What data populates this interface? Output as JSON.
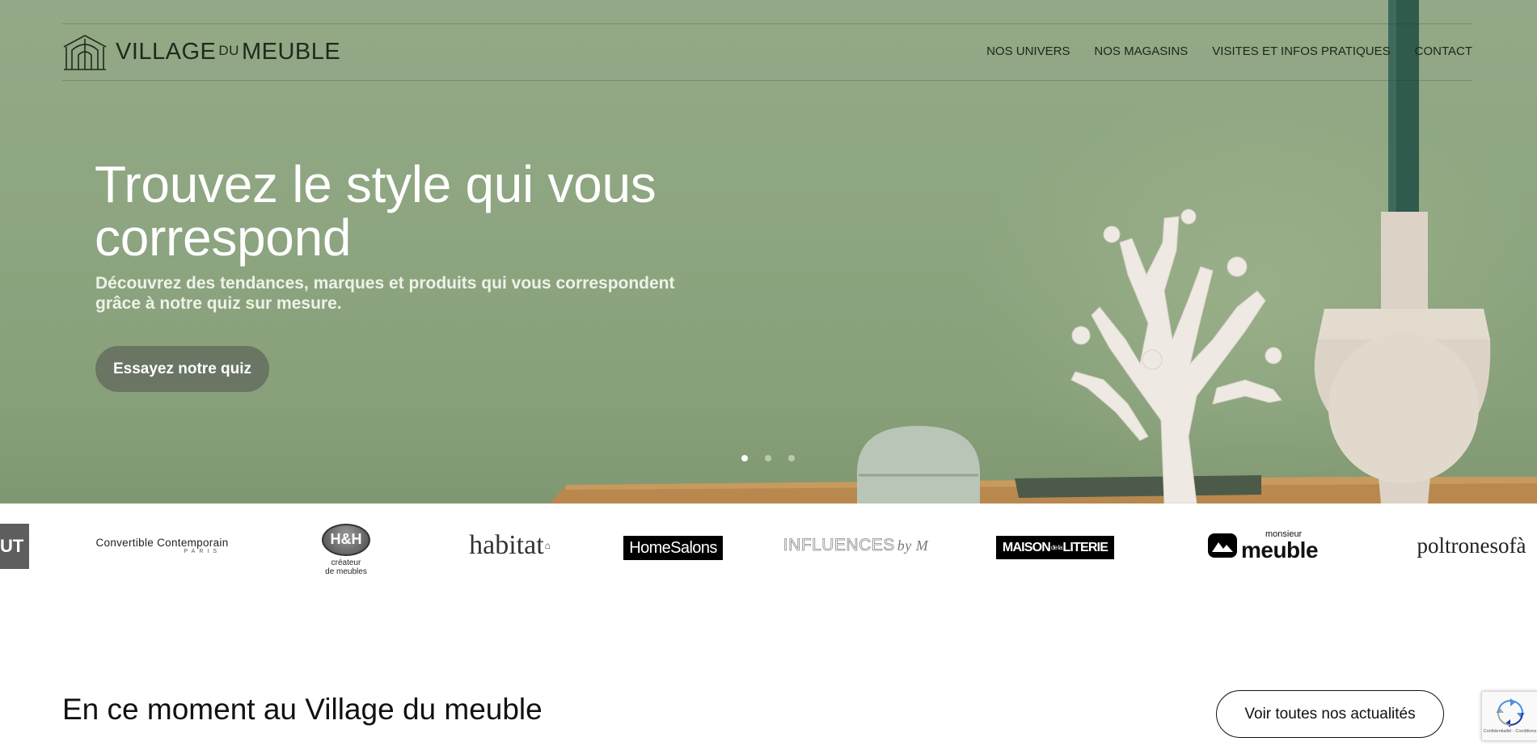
{
  "brand": {
    "name_prefix": "VILLAGE",
    "name_connector": "DU",
    "name_suffix": "MEUBLE"
  },
  "nav": {
    "items": [
      {
        "label": "NOS UNIVERS"
      },
      {
        "label": "NOS MAGASINS"
      },
      {
        "label": "VISITES ET INFOS PRATIQUES"
      },
      {
        "label": "CONTACT"
      }
    ]
  },
  "hero": {
    "title": "Trouvez le style qui vous correspond",
    "subtitle": "Découvrez des tendances, marques et produits qui vous correspondent grâce à notre quiz sur mesure.",
    "cta_label": "Essayez notre quiz",
    "slides_total": 3,
    "active_slide": 1
  },
  "brands": {
    "partial": "UT",
    "convertible_line1": "Convertible Contemporain",
    "convertible_line2": "PARIS",
    "hh_badge": "H&H",
    "hh_sub1": "créateur",
    "hh_sub2": "de meubles",
    "habitat": "habitat",
    "homesalons": "HomeSalons",
    "influences": "INFLUENCES",
    "influences_by": "by M",
    "maison_a": "MAISON",
    "maison_b": "de la",
    "maison_c": "LITERIE",
    "monsieur_small": "monsieur",
    "monsieur_big": "meuble",
    "poltronesofa": "poltronesofà"
  },
  "section": {
    "title": "En ce moment au Village du meuble",
    "button_label": "Voir toutes nos actualités"
  },
  "recaptcha": {
    "footer": "Confidentialité - Conditions"
  },
  "colors": {
    "hero_green": "#8da580",
    "cta_bg": "#6b7564",
    "text_dark": "#111111"
  },
  "icons": {
    "logo": "village-house-icon",
    "recaptcha": "recaptcha-icon"
  }
}
